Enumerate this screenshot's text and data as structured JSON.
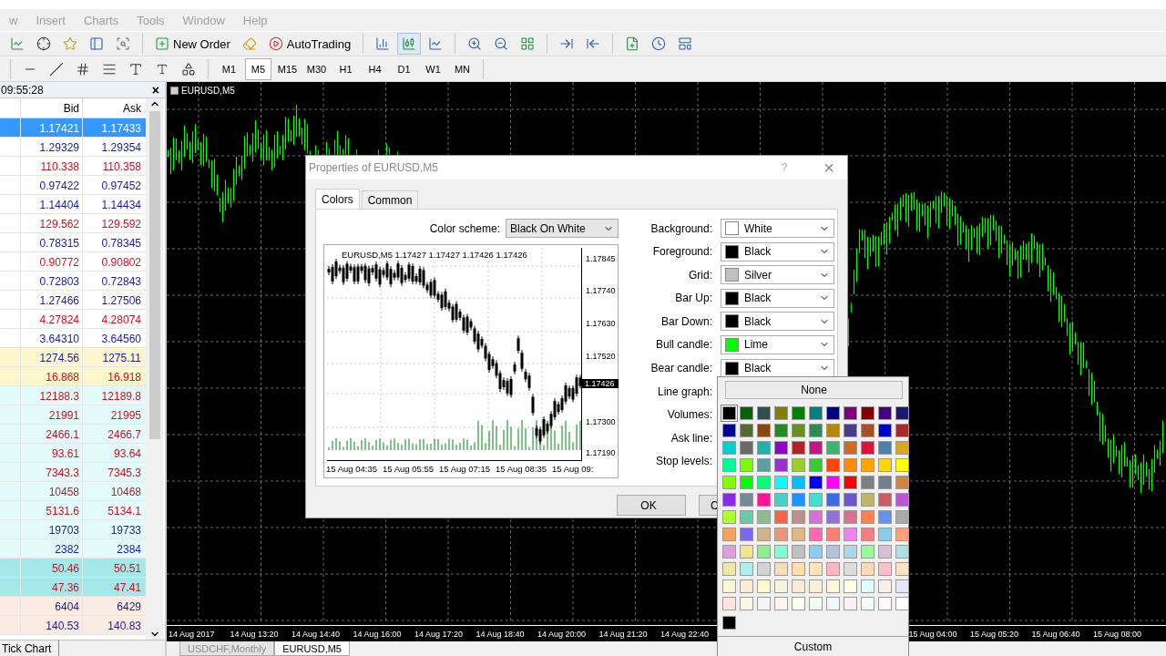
{
  "menu": [
    "w",
    "Insert",
    "Charts",
    "Tools",
    "Window",
    "Help"
  ],
  "toolbar": {
    "new_order": "New Order",
    "auto_trading": "AutoTrading"
  },
  "timeframes": [
    {
      "label": "M1",
      "selected": false
    },
    {
      "label": "M5",
      "selected": true
    },
    {
      "label": "M15",
      "selected": false
    },
    {
      "label": "M30",
      "selected": false
    },
    {
      "label": "H1",
      "selected": false
    },
    {
      "label": "H4",
      "selected": false
    },
    {
      "label": "D1",
      "selected": false
    },
    {
      "label": "W1",
      "selected": false
    },
    {
      "label": "MN",
      "selected": false
    }
  ],
  "market_watch": {
    "time": "09:55:28",
    "close": "×",
    "columns": [
      "Bid",
      "Ask"
    ],
    "rows": [
      {
        "bid": "1.17421",
        "ask": "1.17433",
        "selected": true
      },
      {
        "bid": "1.29329",
        "ask": "1.29354",
        "kind": "plain",
        "color": "#1a1aa8",
        "selected": false
      },
      {
        "bid": "110.338",
        "ask": "110.358",
        "kind": "plain",
        "color": "#d01020",
        "selected": false
      },
      {
        "bid": "0.97422",
        "ask": "0.97452",
        "kind": "plain",
        "color": "#1a1aa8",
        "selected": false
      },
      {
        "bid": "1.14404",
        "ask": "1.14434",
        "kind": "plain",
        "color": "#1a1aa8",
        "selected": false
      },
      {
        "bid": "129.562",
        "ask": "129.592",
        "kind": "plain",
        "color": "#d01020",
        "selected": false
      },
      {
        "bid": "0.78315",
        "ask": "0.78345",
        "kind": "plain",
        "color": "#1a1aa8",
        "selected": false
      },
      {
        "bid": "0.90772",
        "ask": "0.90802",
        "kind": "plain",
        "color": "#d01020",
        "selected": false
      },
      {
        "bid": "0.72803",
        "ask": "0.72843",
        "kind": "plain",
        "color": "#1a1aa8",
        "selected": false
      },
      {
        "bid": "1.27466",
        "ask": "1.27506",
        "kind": "plain",
        "color": "#1a1aa8",
        "selected": false
      },
      {
        "bid": "4.27824",
        "ask": "4.28074",
        "kind": "plain",
        "color": "#d01020",
        "selected": false
      },
      {
        "bid": "3.64310",
        "ask": "3.64560",
        "kind": "plain",
        "color": "#1a1aa8",
        "selected": false
      },
      {
        "bid": "1274.56",
        "ask": "1275.11",
        "kind": "metal",
        "color": "#1a1aa8",
        "selected": false
      },
      {
        "bid": "16.868",
        "ask": "16.918",
        "kind": "metal",
        "color": "#d01020",
        "selected": false
      },
      {
        "bid": "12188.3",
        "ask": "12189.8",
        "kind": "index",
        "color": "#d01020",
        "selected": false
      },
      {
        "bid": "21991",
        "ask": "21995",
        "kind": "index",
        "color": "#d01020",
        "selected": false
      },
      {
        "bid": "2466.1",
        "ask": "2466.7",
        "kind": "index",
        "color": "#d01020",
        "selected": false
      },
      {
        "bid": "93.61",
        "ask": "93.64",
        "kind": "index",
        "color": "#d01020",
        "selected": false
      },
      {
        "bid": "7343.3",
        "ask": "7345.3",
        "kind": "index",
        "color": "#d01020",
        "selected": false
      },
      {
        "bid": "10458",
        "ask": "10468",
        "kind": "index",
        "color": "#d01020",
        "selected": false
      },
      {
        "bid": "5131.6",
        "ask": "5134.1",
        "kind": "index",
        "color": "#d01020",
        "selected": false
      },
      {
        "bid": "19703",
        "ask": "19733",
        "kind": "index",
        "color": "#1a1aa8",
        "selected": false
      },
      {
        "bid": "2382",
        "ask": "2384",
        "kind": "index",
        "color": "#1a1aa8",
        "selected": false
      },
      {
        "bid": "50.46",
        "ask": "50.51",
        "kind": "oil",
        "color": "#d01020",
        "selected": false
      },
      {
        "bid": "47.36",
        "ask": "47.41",
        "kind": "oil",
        "color": "#d01020",
        "selected": false
      },
      {
        "bid": "6404",
        "ask": "6429",
        "kind": "other",
        "color": "#1a1aa8",
        "selected": false
      },
      {
        "bid": "140.53",
        "ask": "140.83",
        "kind": "other",
        "color": "#1a1aa8",
        "selected": false
      }
    ],
    "tab": "Tick Chart"
  },
  "chart": {
    "title": "EURUSD,M5",
    "time_labels": [
      "14 Aug 2017",
      "14 Aug 13:20",
      "14 Aug 14:40",
      "14 Aug 16:00",
      "14 Aug 17:20",
      "14 Aug 18:40",
      "14 Aug 20:00",
      "14 Aug 21:20",
      "14 Aug 22:40"
    ],
    "time_labels_right": [
      "15 Aug 04:00",
      "15 Aug 05:20",
      "15 Aug 06:40",
      "15 Aug 08:00"
    ],
    "tabs": [
      {
        "label": "USDCHF,Monthly",
        "selected": false
      },
      {
        "label": "EURUSD,M5",
        "selected": true
      }
    ]
  },
  "dialog": {
    "title": "Properties of EURUSD,M5",
    "help": "?",
    "close": "×",
    "tabs": [
      {
        "label": "Colors",
        "selected": true
      },
      {
        "label": "Common",
        "selected": false
      }
    ],
    "scheme_label": "Color scheme:",
    "scheme_value": "Black On White",
    "preview": {
      "header": "EURUSD,M5  1.17427 1.17427 1.17426 1.17426",
      "price_labels": [
        "1.17845",
        "1.17740",
        "1.17630",
        "1.17520",
        "1.17300",
        "1.17190"
      ],
      "current_price": "1.17426",
      "time_labels": [
        "15 Aug 04:35",
        "15 Aug 05:55",
        "15 Aug 07:15",
        "15 Aug 08:35",
        "15 Aug 09:"
      ]
    },
    "properties": [
      {
        "label": "Background:",
        "value": "White",
        "color": "#ffffff"
      },
      {
        "label": "Foreground:",
        "value": "Black",
        "color": "#000000"
      },
      {
        "label": "Grid:",
        "value": "Silver",
        "color": "#c0c0c0"
      },
      {
        "label": "Bar Up:",
        "value": "Black",
        "color": "#000000"
      },
      {
        "label": "Bar Down:",
        "value": "Black",
        "color": "#000000"
      },
      {
        "label": "Bull candle:",
        "value": "Lime",
        "color": "#00ff00"
      },
      {
        "label": "Bear candle:",
        "value": "Black",
        "color": "#000000"
      },
      {
        "label": "Line graph:"
      },
      {
        "label": "Volumes:"
      },
      {
        "label": "Ask line:"
      },
      {
        "label": "Stop levels:"
      }
    ],
    "ok": "OK",
    "cancel": "C"
  },
  "color_picker": {
    "none": "None",
    "custom": "Custom",
    "recent": [
      {
        "color": "#000000"
      }
    ],
    "swatches": [
      {
        "color": "#000000",
        "selected": true
      },
      {
        "color": "#006400",
        "selected": false
      },
      {
        "color": "#2f4f4f",
        "selected": false
      },
      {
        "color": "#808000",
        "selected": false
      },
      {
        "color": "#008000",
        "selected": false
      },
      {
        "color": "#008080",
        "selected": false
      },
      {
        "color": "#000080",
        "selected": false
      },
      {
        "color": "#800080",
        "selected": false
      },
      {
        "color": "#800000",
        "selected": false
      },
      {
        "color": "#4b0082",
        "selected": false
      },
      {
        "color": "#191970",
        "selected": false
      },
      {
        "color": "#00008b",
        "selected": false
      },
      {
        "color": "#556b2f",
        "selected": false
      },
      {
        "color": "#8b4513",
        "selected": false
      },
      {
        "color": "#228b22",
        "selected": false
      },
      {
        "color": "#6b8e23",
        "selected": false
      },
      {
        "color": "#2e8b57",
        "selected": false
      },
      {
        "color": "#b8860b",
        "selected": false
      },
      {
        "color": "#483d8b",
        "selected": false
      },
      {
        "color": "#a0522d",
        "selected": false
      },
      {
        "color": "#0000cd",
        "selected": false
      },
      {
        "color": "#a52a2a",
        "selected": false
      },
      {
        "color": "#00ced1",
        "selected": false
      },
      {
        "color": "#696969",
        "selected": false
      },
      {
        "color": "#20b2aa",
        "selected": false
      },
      {
        "color": "#9400d3",
        "selected": false
      },
      {
        "color": "#b22222",
        "selected": false
      },
      {
        "color": "#c71585",
        "selected": false
      },
      {
        "color": "#3cb371",
        "selected": false
      },
      {
        "color": "#d2691e",
        "selected": false
      },
      {
        "color": "#dc143c",
        "selected": false
      },
      {
        "color": "#4682b4",
        "selected": false
      },
      {
        "color": "#daa520",
        "selected": false
      },
      {
        "color": "#00fa9a",
        "selected": false
      },
      {
        "color": "#7cfc00",
        "selected": false
      },
      {
        "color": "#5f9ea0",
        "selected": false
      },
      {
        "color": "#9932cc",
        "selected": false
      },
      {
        "color": "#9acd32",
        "selected": false
      },
      {
        "color": "#32cd32",
        "selected": false
      },
      {
        "color": "#ff4500",
        "selected": false
      },
      {
        "color": "#ff8c00",
        "selected": false
      },
      {
        "color": "#ffa500",
        "selected": false
      },
      {
        "color": "#ffd700",
        "selected": false
      },
      {
        "color": "#ffff00",
        "selected": false
      },
      {
        "color": "#7fff00",
        "selected": false
      },
      {
        "color": "#00ff00",
        "selected": false
      },
      {
        "color": "#00ff7f",
        "selected": false
      },
      {
        "color": "#00ffff",
        "selected": false
      },
      {
        "color": "#00bfff",
        "selected": false
      },
      {
        "color": "#0000ff",
        "selected": false
      },
      {
        "color": "#ff00ff",
        "selected": false
      },
      {
        "color": "#ff0000",
        "selected": false
      },
      {
        "color": "#808080",
        "selected": false
      },
      {
        "color": "#708090",
        "selected": false
      },
      {
        "color": "#cd853f",
        "selected": false
      },
      {
        "color": "#8a2be2",
        "selected": false
      },
      {
        "color": "#778899",
        "selected": false
      },
      {
        "color": "#ff1493",
        "selected": false
      },
      {
        "color": "#48d1cc",
        "selected": false
      },
      {
        "color": "#1e90ff",
        "selected": false
      },
      {
        "color": "#40e0d0",
        "selected": false
      },
      {
        "color": "#4169e1",
        "selected": false
      },
      {
        "color": "#6a5acd",
        "selected": false
      },
      {
        "color": "#bdb76b",
        "selected": false
      },
      {
        "color": "#cd5c5c",
        "selected": false
      },
      {
        "color": "#ba55d3",
        "selected": false
      },
      {
        "color": "#adff2f",
        "selected": false
      },
      {
        "color": "#66cdaa",
        "selected": false
      },
      {
        "color": "#8fbc8f",
        "selected": false
      },
      {
        "color": "#ff6347",
        "selected": false
      },
      {
        "color": "#bc8f8f",
        "selected": false
      },
      {
        "color": "#da70d6",
        "selected": false
      },
      {
        "color": "#9370db",
        "selected": false
      },
      {
        "color": "#db7093",
        "selected": false
      },
      {
        "color": "#ff7f50",
        "selected": false
      },
      {
        "color": "#6495ed",
        "selected": false
      },
      {
        "color": "#a9a9a9",
        "selected": false
      },
      {
        "color": "#f4a460",
        "selected": false
      },
      {
        "color": "#7b68ee",
        "selected": false
      },
      {
        "color": "#d2b48c",
        "selected": false
      },
      {
        "color": "#e9967a",
        "selected": false
      },
      {
        "color": "#deb887",
        "selected": false
      },
      {
        "color": "#ff69b4",
        "selected": false
      },
      {
        "color": "#fa8072",
        "selected": false
      },
      {
        "color": "#ee82ee",
        "selected": false
      },
      {
        "color": "#f08080",
        "selected": false
      },
      {
        "color": "#87ceeb",
        "selected": false
      },
      {
        "color": "#ffa07a",
        "selected": false
      },
      {
        "color": "#dda0dd",
        "selected": false
      },
      {
        "color": "#f0e68c",
        "selected": false
      },
      {
        "color": "#90ee90",
        "selected": false
      },
      {
        "color": "#7fffd4",
        "selected": false
      },
      {
        "color": "#c0c0c0",
        "selected": false
      },
      {
        "color": "#87cefa",
        "selected": false
      },
      {
        "color": "#b0c4de",
        "selected": false
      },
      {
        "color": "#add8e6",
        "selected": false
      },
      {
        "color": "#98fb98",
        "selected": false
      },
      {
        "color": "#d8bfd8",
        "selected": false
      },
      {
        "color": "#b0e0e6",
        "selected": false
      },
      {
        "color": "#eee8aa",
        "selected": false
      },
      {
        "color": "#afeeee",
        "selected": false
      },
      {
        "color": "#d3d3d3",
        "selected": false
      },
      {
        "color": "#f5deb3",
        "selected": false
      },
      {
        "color": "#ffdead",
        "selected": false
      },
      {
        "color": "#ffe4b5",
        "selected": false
      },
      {
        "color": "#ffb6c1",
        "selected": false
      },
      {
        "color": "#dcdcdc",
        "selected": false
      },
      {
        "color": "#ffdab9",
        "selected": false
      },
      {
        "color": "#ffc0cb",
        "selected": false
      },
      {
        "color": "#ffe4c4",
        "selected": false
      },
      {
        "color": "#fafad2",
        "selected": false
      },
      {
        "color": "#ffebcd",
        "selected": false
      },
      {
        "color": "#fffacd",
        "selected": false
      },
      {
        "color": "#f5f5dc",
        "selected": false
      },
      {
        "color": "#faebd7",
        "selected": false
      },
      {
        "color": "#ffefd5",
        "selected": false
      },
      {
        "color": "#fff8dc",
        "selected": false
      },
      {
        "color": "#ffffe0",
        "selected": false
      },
      {
        "color": "#e0ffff",
        "selected": false
      },
      {
        "color": "#faf0e6",
        "selected": false
      },
      {
        "color": "#e6e6fa",
        "selected": false
      },
      {
        "color": "#ffe4e1",
        "selected": false
      },
      {
        "color": "#fdf5e6",
        "selected": false
      },
      {
        "color": "#f5f5f5",
        "selected": false
      },
      {
        "color": "#fff5ee",
        "selected": false
      },
      {
        "color": "#fffff0",
        "selected": false
      },
      {
        "color": "#f0fff0",
        "selected": false
      },
      {
        "color": "#f0f8ff",
        "selected": false
      },
      {
        "color": "#fff0f5",
        "selected": false
      },
      {
        "color": "#f5fffa",
        "selected": false
      },
      {
        "color": "#fffafa",
        "selected": false
      },
      {
        "color": "#ffffff",
        "selected": false
      }
    ]
  }
}
